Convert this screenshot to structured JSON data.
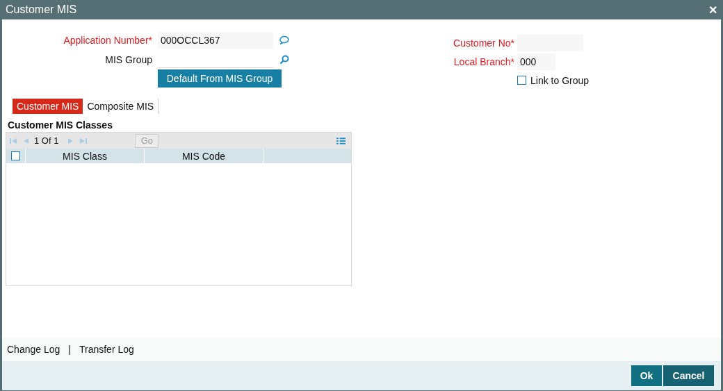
{
  "window": {
    "title": "Customer MIS",
    "close": "✕"
  },
  "fields_left": [
    {
      "label": "Application Number",
      "required": true,
      "mark": "*",
      "value": "000OCCL367",
      "kind": "chat"
    },
    {
      "label": "MIS Group",
      "required": false,
      "kind": "search"
    }
  ],
  "default_button": "Default From MIS Group",
  "fields_right": [
    {
      "label": "Customer No",
      "required": true,
      "mark": "*",
      "kind": "wide"
    },
    {
      "label": "Local Branch",
      "required": true,
      "mark": "*",
      "value": "000",
      "kind": "narrow"
    }
  ],
  "link_to_group": {
    "label": "Link to Group",
    "checked": false
  },
  "tabs": [
    {
      "label": "Customer MIS",
      "selected": true
    },
    {
      "label": "Composite MIS",
      "selected": false
    }
  ],
  "section_title": "Customer MIS Classes",
  "grid": {
    "pager": "1 Of 1",
    "go": "Go",
    "select_all": false,
    "columns": [
      "MIS Class",
      "MIS Code"
    ]
  },
  "footer_links": [
    "Change Log",
    "Transfer Log"
  ],
  "footer_separator": "|",
  "buttons": [
    "Ok",
    "Cancel"
  ]
}
